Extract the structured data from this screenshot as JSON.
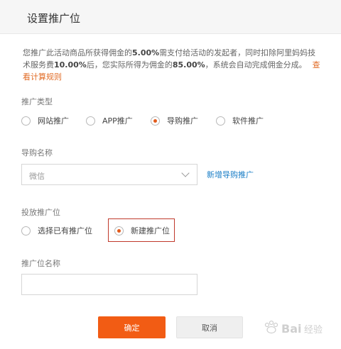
{
  "dialog": {
    "title": "设置推广位"
  },
  "notice": {
    "part1": "您推广此活动商品所获得佣金的",
    "pct1": "5.00%",
    "part2": "需支付给活动的发起者，同时扣除阿里妈妈技术服务费",
    "pct2": "10.00%",
    "part3": "后，您实际所得为佣金的",
    "pct3": "85.00%",
    "part4": "，系统会自动完成佣金分成。",
    "link": "查看计算规则",
    "link_color": "#e16b25"
  },
  "promo_type": {
    "label": "推广类型",
    "options": [
      {
        "label": "网站推广",
        "checked": false
      },
      {
        "label": "APP推广",
        "checked": false
      },
      {
        "label": "导购推广",
        "checked": true
      },
      {
        "label": "软件推广",
        "checked": false
      }
    ]
  },
  "guide_name": {
    "label": "导购名称",
    "value": "微信",
    "new_link": "新增导购推广"
  },
  "placement": {
    "label": "投放推广位",
    "options": [
      {
        "label": "选择已有推广位",
        "checked": false
      },
      {
        "label": "新建推广位",
        "checked": true
      }
    ]
  },
  "placement_name": {
    "label": "推广位名称",
    "value": ""
  },
  "buttons": {
    "confirm": "确定",
    "cancel": "取消"
  },
  "watermark": {
    "text": "Baidu经验"
  },
  "colors": {
    "accent": "#f25c14",
    "link": "#1a7ec6",
    "highlight_border": "#c0392b"
  }
}
